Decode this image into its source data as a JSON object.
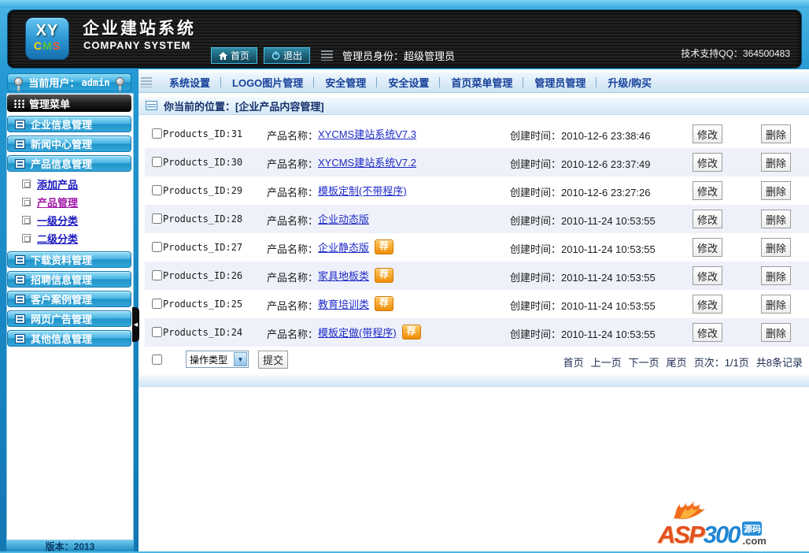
{
  "colors": {
    "frame_blue": "#1e8fc8",
    "header_dark": "#1a1a1a",
    "sidebar_button_blue": "#35a7da",
    "link_blue": "#1d2ac8",
    "active_link_purple": "#a018a8",
    "badge_orange": "#ef8d05",
    "menu_text_navy": "#16419b"
  },
  "header": {
    "logo_xy": "XY",
    "logo_c": "C",
    "logo_m": "M",
    "logo_s": "S",
    "title_cn": "企业建站系统",
    "title_en": "COMPANY SYSTEM",
    "home_label": "首页",
    "logout_label": "退出",
    "admin_identity": "管理员身份：超级管理员",
    "support": "技术支持QQ：364500483"
  },
  "topmenu": {
    "items": [
      "系统设置",
      "LOGO图片管理",
      "安全管理",
      "安全设置",
      "首页菜单管理",
      "管理员管理",
      "升级/购买"
    ]
  },
  "sidebar": {
    "current_user_label": "当前用户：",
    "current_user": "admin",
    "menu_title": "管理菜单",
    "items_top": [
      "企业信息管理",
      "新闻中心管理",
      "产品信息管理"
    ],
    "submenu": [
      {
        "label": "添加产品",
        "active": false
      },
      {
        "label": "产品管理",
        "active": true
      },
      {
        "label": "一级分类",
        "active": false
      },
      {
        "label": "二级分类",
        "active": false
      }
    ],
    "items_bottom": [
      "下载资料管理",
      "招聘信息管理",
      "客户案例管理",
      "网页广告管理",
      "其他信息管理"
    ],
    "version": "版本：2013"
  },
  "breadcrumb": {
    "label": "你当前的位置：[企业产品内容管理]"
  },
  "table": {
    "name_label": "产品名称：",
    "time_label": "创建时间：",
    "edit_label": "修改",
    "delete_label": "删除",
    "rows": [
      {
        "id": "Products_ID:31",
        "name": "XYCMS建站系统V7.3",
        "time": "2010-12-6 23:38:46",
        "badge": ""
      },
      {
        "id": "Products_ID:30",
        "name": "XYCMS建站系统V7.2",
        "time": "2010-12-6 23:37:49",
        "badge": ""
      },
      {
        "id": "Products_ID:29",
        "name": "模板定制(不带程序)",
        "time": "2010-12-6 23:27:26",
        "badge": ""
      },
      {
        "id": "Products_ID:28",
        "name": "企业动态版",
        "time": "2010-11-24 10:53:55",
        "badge": ""
      },
      {
        "id": "Products_ID:27",
        "name": "企业静态版",
        "time": "2010-11-24 10:53:55",
        "badge": "荐"
      },
      {
        "id": "Products_ID:26",
        "name": "家具地板类",
        "time": "2010-11-24 10:53:55",
        "badge": "荐"
      },
      {
        "id": "Products_ID:25",
        "name": "教育培训类",
        "time": "2010-11-24 10:53:55",
        "badge": "荐"
      },
      {
        "id": "Products_ID:24",
        "name": "模板定做(带程序)",
        "time": "2010-11-24 10:53:55",
        "badge": "荐"
      }
    ]
  },
  "footer": {
    "action_select": "操作类型",
    "submit": "提交",
    "nav": [
      "首页",
      "上一页",
      "下一页",
      "尾页"
    ],
    "page_info": "页次：1/1页",
    "records_info": "共8条记录"
  },
  "glyphs": {
    "select_arrow": "▼",
    "collapse": "◀"
  },
  "watermark": {
    "asp": "ASP",
    "num": "300",
    "yuanma": "源码",
    "com": ".com"
  }
}
